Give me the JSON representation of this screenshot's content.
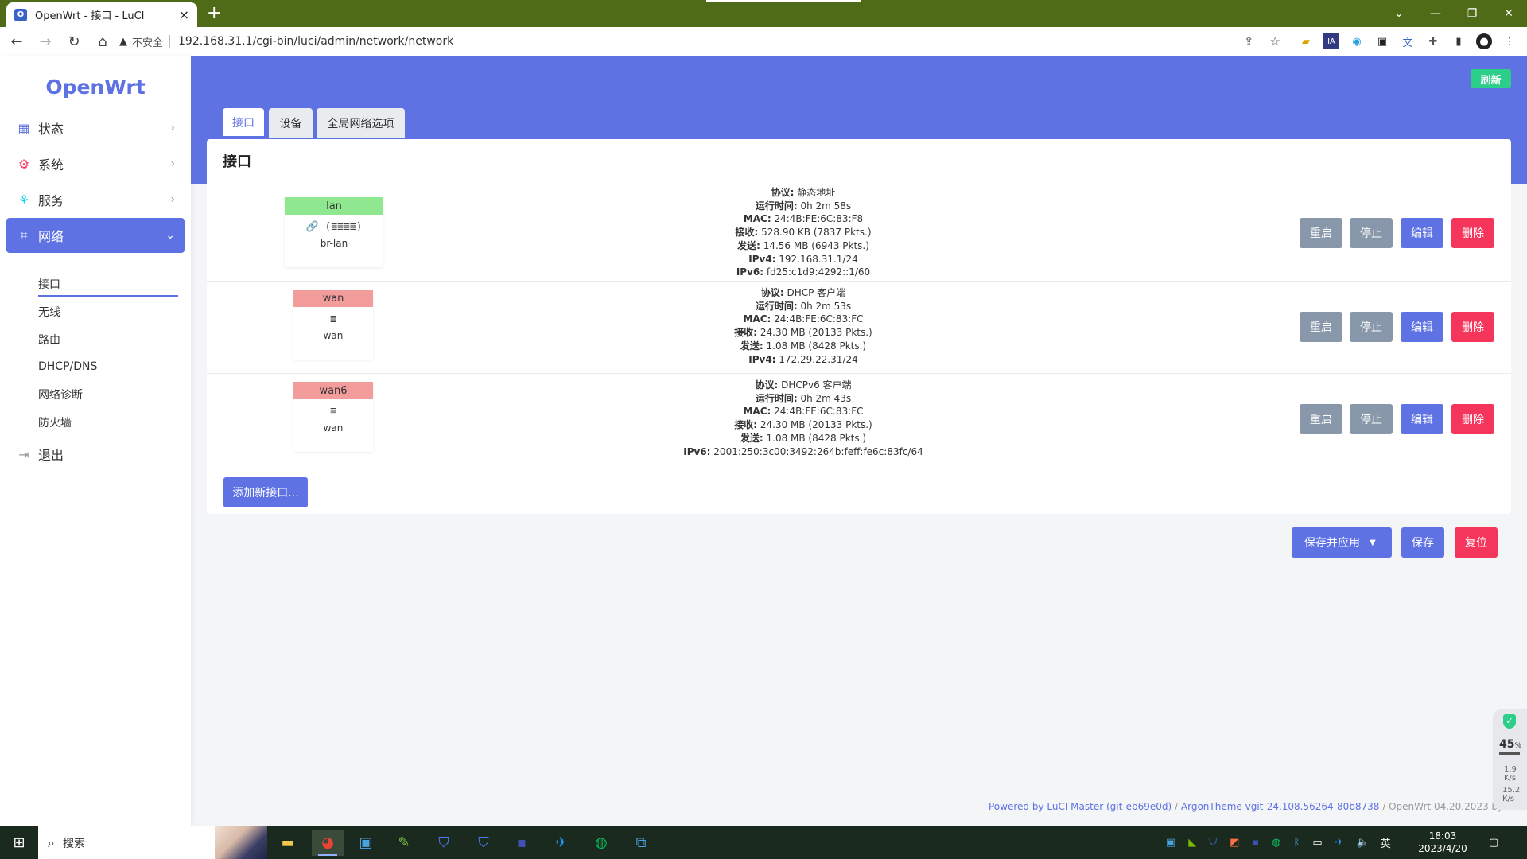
{
  "browser": {
    "tab_title": "OpenWrt - 接口 - LuCI",
    "tab_close": "×",
    "new_tab": "+",
    "security_label": "不安全",
    "url": "192.168.31.1/cgi-bin/luci/admin/network/network"
  },
  "sidebar": {
    "logo": "OpenWrt",
    "menu": [
      {
        "label": "状态"
      },
      {
        "label": "系统"
      },
      {
        "label": "服务"
      },
      {
        "label": "网络"
      },
      {
        "label": "退出"
      }
    ],
    "submenu": [
      {
        "label": "接口"
      },
      {
        "label": "无线"
      },
      {
        "label": "路由"
      },
      {
        "label": "DHCP/DNS"
      },
      {
        "label": "网络诊断"
      },
      {
        "label": "防火墙"
      }
    ]
  },
  "header": {
    "refresh_label": "刷新",
    "tabs": [
      {
        "label": "接口"
      },
      {
        "label": "设备"
      },
      {
        "label": "全局网络选项"
      }
    ]
  },
  "panel": {
    "title": "接口",
    "interfaces": [
      {
        "name": "lan",
        "color": "#8fe88f",
        "icon_text": "🔗 (≣≣≣≣)",
        "device": "br-lan",
        "info": [
          {
            "k": "协议:",
            "v": " 静态地址"
          },
          {
            "k": "运行时间:",
            "v": " 0h 2m 58s"
          },
          {
            "k": "MAC:",
            "v": " 24:4B:FE:6C:83:F8"
          },
          {
            "k": "接收:",
            "v": " 528.90 KB (7837 Pkts.)"
          },
          {
            "k": "发送:",
            "v": " 14.56 MB (6943 Pkts.)"
          },
          {
            "k": "IPv4:",
            "v": " 192.168.31.1/24"
          },
          {
            "k": "IPv6:",
            "v": " fd25:c1d9:4292::1/60"
          }
        ]
      },
      {
        "name": "wan",
        "color": "#f39c9c",
        "icon_text": "≣",
        "device": "wan",
        "info": [
          {
            "k": "协议:",
            "v": " DHCP 客户端"
          },
          {
            "k": "运行时间:",
            "v": " 0h 2m 53s"
          },
          {
            "k": "MAC:",
            "v": " 24:4B:FE:6C:83:FC"
          },
          {
            "k": "接收:",
            "v": " 24.30 MB (20133 Pkts.)"
          },
          {
            "k": "发送:",
            "v": " 1.08 MB (8428 Pkts.)"
          },
          {
            "k": "IPv4:",
            "v": " 172.29.22.31/24"
          }
        ]
      },
      {
        "name": "wan6",
        "color": "#f39c9c",
        "icon_text": "≣",
        "device": "wan",
        "info": [
          {
            "k": "协议:",
            "v": " DHCPv6 客户端"
          },
          {
            "k": "运行时间:",
            "v": " 0h 2m 43s"
          },
          {
            "k": "MAC:",
            "v": " 24:4B:FE:6C:83:FC"
          },
          {
            "k": "接收:",
            "v": " 24.30 MB (20133 Pkts.)"
          },
          {
            "k": "发送:",
            "v": " 1.08 MB (8428 Pkts.)"
          },
          {
            "k": "IPv6:",
            "v": " 2001:250:3c00:3492:264b:feff:fe6c:83fc/64"
          }
        ]
      }
    ],
    "row_buttons": {
      "restart": "重启",
      "stop": "停止",
      "edit": "编辑",
      "delete": "删除"
    },
    "add_button": "添加新接口..."
  },
  "actions": {
    "save_apply": "保存并应用",
    "save_apply_caret": "▼",
    "save": "保存",
    "reset": "复位"
  },
  "footer": {
    "powered": "Powered by LuCI Master (git-eb69e0d)",
    "sep1": " / ",
    "theme": "ArgonTheme vgit-24.108.56264-80b8738",
    "rest": " / OpenWrt 04.20.2023 by Kiddin'"
  },
  "widget": {
    "cpu": "45",
    "cpu_unit": "%",
    "up_value": "1.9",
    "up_unit": "K/s",
    "down_value": "15.2",
    "down_unit": "K/s"
  },
  "taskbar": {
    "search_label": "搜索",
    "ime": "英",
    "time": "18:03",
    "date": "2023/4/20"
  },
  "colors": {
    "accent": "#5e72e4",
    "success": "#2dce89",
    "danger": "#f5365c",
    "neutral": "#8898aa",
    "tabstrip": "#4f6b17"
  }
}
